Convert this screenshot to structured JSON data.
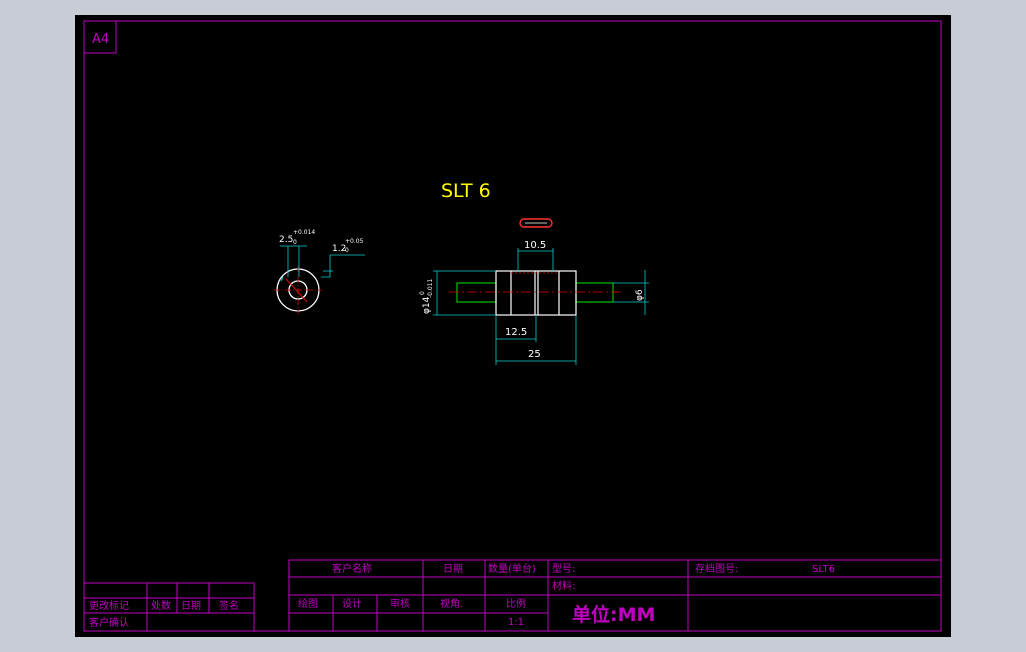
{
  "sheet": {
    "size_label": "A4"
  },
  "drawing": {
    "title": "SLT 6",
    "end_view": {
      "dim_a_value": "2.5",
      "dim_a_tol_upper": "+0.014",
      "dim_a_tol_lower": "0",
      "dim_b_value": "1.2",
      "dim_b_tol_upper": "+0.05",
      "dim_b_tol_lower": "0"
    },
    "side_view": {
      "dim_top": "10.5",
      "dim_half_length": "12.5",
      "dim_total_length": "25",
      "dim_left_diameter": "φ14",
      "dim_left_diameter_tol_upper": "0",
      "dim_left_diameter_tol_lower": "-0.011",
      "dim_right_diameter": "φ6"
    }
  },
  "title_block": {
    "customer_name_label": "客户名称",
    "date_label": "日期",
    "quantity_label": "数量(单台)",
    "model_label": "型号:",
    "archive_no_label": "存档图号:",
    "archive_no_value": "SLT6",
    "material_label": "材料:",
    "drawing_label": "绘图",
    "design_label": "设计",
    "review_label": "审核",
    "view_angle_label": "视角.",
    "scale_label": "比例",
    "scale_value": "1:1",
    "unit_text": "单位:MM"
  },
  "revision_block": {
    "change_mark_label": "更改标记",
    "count_label": "处数",
    "date_label": "日期",
    "signature_label": "签名",
    "customer_confirm_label": "客户确认"
  },
  "colors": {
    "background": "#000000",
    "frame": "#c000c0",
    "dimension": "#00d0d0",
    "outline": "#ffffff",
    "title": "#ffff00",
    "center_line": "#e00000",
    "shaft": "#00c000"
  }
}
